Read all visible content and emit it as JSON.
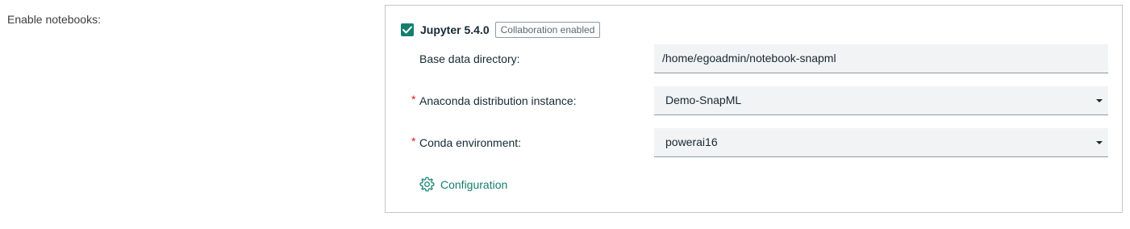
{
  "section": {
    "label": "Enable notebooks:"
  },
  "notebook": {
    "checked": true,
    "title": "Jupyter 5.4.0",
    "badge": "Collaboration enabled"
  },
  "fields": {
    "base_dir": {
      "label": "Base data directory:",
      "value": "/home/egoadmin/notebook-snapml"
    },
    "anaconda": {
      "required_mark": "*",
      "label": "Anaconda distribution instance:",
      "value": "Demo-SnapML"
    },
    "conda_env": {
      "required_mark": "*",
      "label": "Conda environment:",
      "value": "powerai16"
    }
  },
  "configuration": {
    "label": "Configuration",
    "icon": "gear-icon"
  },
  "colors": {
    "accent": "#147e6e",
    "required": "#e0182d",
    "field_bg": "#f2f3f4"
  }
}
